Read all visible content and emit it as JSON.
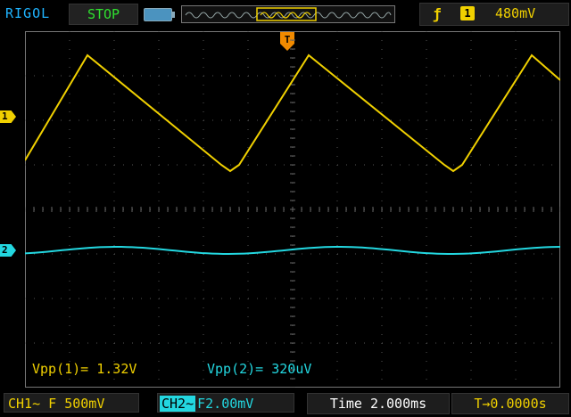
{
  "header": {
    "brand": "RIGOL",
    "run_state": "STOP",
    "trigger_source_badge": "1",
    "trigger_level": "480mV"
  },
  "channels": {
    "ch1_marker": "1",
    "ch2_marker": "2"
  },
  "trigger_marker_label": "T",
  "measurements": {
    "vpp1": "Vpp(1)= 1.32V",
    "vpp2": "Vpp(2)= 320uV"
  },
  "footer": {
    "ch1": "CH1~ F 500mV",
    "ch2_tag": "CH2~",
    "ch2_scale": "F2.00mV",
    "time": "Time 2.000ms",
    "trigger_offset": "T→0.0000s"
  },
  "colors": {
    "ch1": "#f0d000",
    "ch2": "#23d7e0",
    "brand": "#1fb4ff",
    "stop": "#2fe02f"
  }
}
